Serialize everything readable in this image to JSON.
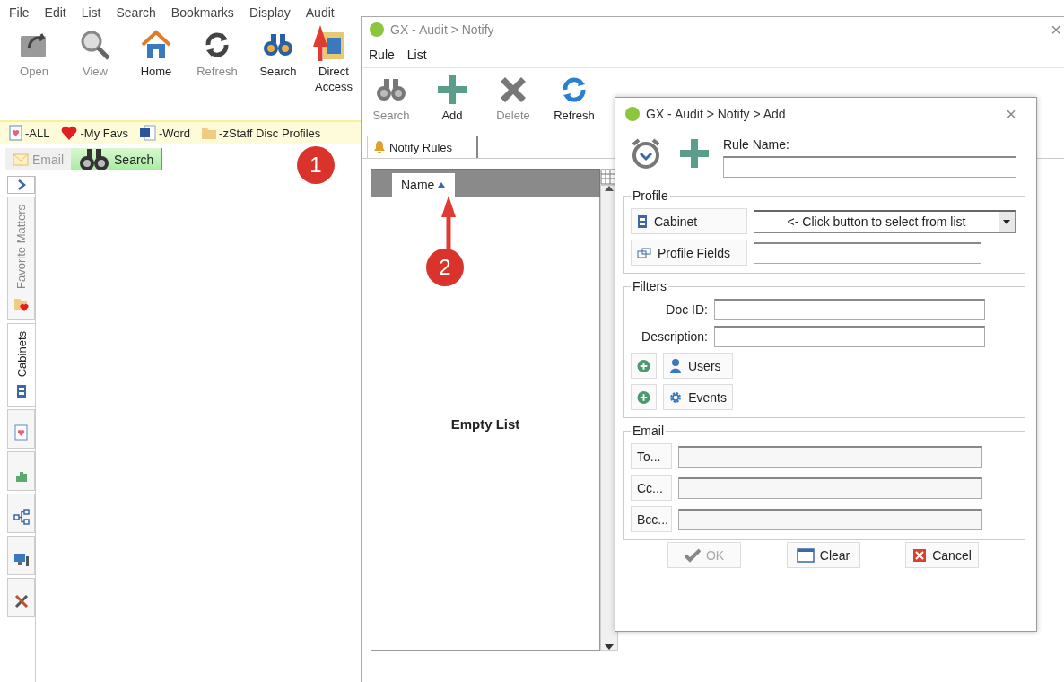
{
  "main_window": {
    "menu": [
      "File",
      "Edit",
      "List",
      "Search",
      "Bookmarks",
      "Display",
      "Audit"
    ],
    "toolbar": [
      {
        "label": "Open",
        "kind": "open",
        "disabled": true
      },
      {
        "label": "View",
        "kind": "view",
        "disabled": true
      },
      {
        "label": "Home",
        "kind": "home",
        "disabled": false
      },
      {
        "label": "Refresh",
        "kind": "refresh",
        "disabled": true
      },
      {
        "label": "Search",
        "kind": "search",
        "disabled": false
      },
      {
        "label": "Direct Access",
        "kind": "direct",
        "disabled": false
      }
    ],
    "favorites": [
      {
        "label": "-ALL",
        "kind": "doc-heart"
      },
      {
        "label": "-My Favs",
        "kind": "heart"
      },
      {
        "label": "-Word",
        "kind": "word"
      },
      {
        "label": "-zStaff Disc Profiles",
        "kind": "folder"
      }
    ],
    "tabs": [
      {
        "label": "Email",
        "kind": "mail",
        "selected": false
      },
      {
        "label": "Search",
        "kind": "binoculars",
        "selected": true
      }
    ],
    "sidebar": [
      {
        "label": "Favorite Matters",
        "kind": "folder-heart",
        "selected": false
      },
      {
        "label": "Cabinets",
        "kind": "cabinet",
        "selected": true
      },
      {
        "kind": "doc-heart",
        "selected": false
      },
      {
        "kind": "chart",
        "selected": false
      },
      {
        "kind": "hierarchy",
        "selected": false
      },
      {
        "kind": "computer",
        "selected": false
      },
      {
        "kind": "tools",
        "selected": false
      }
    ]
  },
  "notify_window": {
    "title": "GX - Audit > Notify",
    "close": "×",
    "menu": [
      "Rule",
      "List"
    ],
    "toolbar": [
      {
        "label": "Search",
        "kind": "binoculars",
        "disabled": true
      },
      {
        "label": "Add",
        "kind": "add",
        "disabled": false
      },
      {
        "label": "Delete",
        "kind": "delete",
        "disabled": true
      },
      {
        "label": "Refresh",
        "kind": "refresh",
        "disabled": false
      }
    ],
    "tab": "Notify Rules",
    "columns": [
      "Name"
    ],
    "empty_text": "Empty List"
  },
  "add_dialog": {
    "title": "GX - Audit > Notify > Add",
    "close": "×",
    "rule_name_label": "Rule Name:",
    "profile": {
      "legend": "Profile",
      "cabinet_button": "Cabinet",
      "cabinet_select": "<- Click button to select from list",
      "fields_button": "Profile Fields"
    },
    "filters": {
      "legend": "Filters",
      "fields": [
        "Doc ID:",
        "Description:"
      ],
      "lists": [
        {
          "label": "Users",
          "kind": "user"
        },
        {
          "label": "Events",
          "kind": "gear"
        }
      ]
    },
    "email": {
      "legend": "Email",
      "fields": [
        "To...",
        "Cc...",
        "Bcc..."
      ]
    },
    "buttons": [
      {
        "label": "OK",
        "kind": "check",
        "disabled": true
      },
      {
        "label": "Clear",
        "kind": "window",
        "disabled": false
      },
      {
        "label": "Cancel",
        "kind": "cancel",
        "disabled": false
      }
    ]
  },
  "annotations": [
    {
      "label": "1"
    },
    {
      "label": "2"
    }
  ]
}
